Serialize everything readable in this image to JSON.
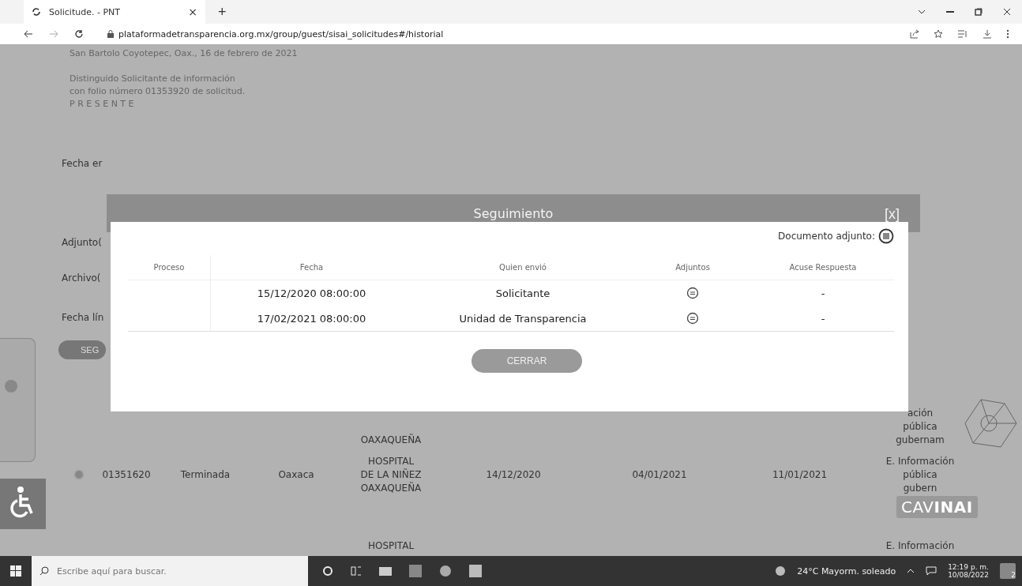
{
  "browser": {
    "tab_title": "Solicitude. - PNT",
    "tab_close": "×",
    "new_tab": "+",
    "url": "plataformadetransparencia.org.mx/group/guest/sisai_solicitudes#/historial"
  },
  "letter": {
    "lines": [
      "San Bartolo Coyotepec, Oax., 16 de febrero de 2021",
      "Distinguido Solicitante de información",
      "con folio número 01353920 de  solicitud.",
      "P R E S E N T E"
    ]
  },
  "form_labels": [
    "Fecha er",
    "Adjunto(",
    "Archivo(",
    "Fecha lín"
  ],
  "partial_button": "SEG",
  "background_rows": [
    {
      "institution": [
        "OAXAQUEÑA"
      ],
      "type": [
        "ación",
        "pública",
        "gubernam"
      ]
    },
    {
      "folio": "01351620",
      "status": "Terminada",
      "state": "Oaxaca",
      "institution": [
        "HOSPITAL",
        "DE LA NIÑEZ",
        "OAXAQUEÑA"
      ],
      "date_1": "14/12/2020",
      "date_2": "04/01/2021",
      "date_3": "11/01/2021",
      "type": [
        "E. Información",
        "pública",
        "gubern"
      ]
    },
    {
      "institution": [
        "HOSPITAL"
      ],
      "type": [
        "E. Información"
      ]
    }
  ],
  "modal": {
    "title": "Seguimiento",
    "close": "[x]",
    "attachment_label": "Documento adjunto:",
    "columns": [
      "Proceso",
      "Fecha",
      "Quien envió",
      "Adjuntos",
      "Acuse Respuesta"
    ],
    "rows": [
      {
        "date": "15/12/2020 08:00:00",
        "sender": "Solicitante",
        "response": "-"
      },
      {
        "date": "17/02/2021 08:00:00",
        "sender": "Unidad de Transparencia",
        "response": "-"
      }
    ],
    "button": "CERRAR"
  },
  "chat_widget": {
    "label": "CAV**INAI**"
  },
  "taskbar": {
    "search_placeholder": "Escribe aquí para buscar.",
    "weather": "24°C Mayorm. soleado",
    "time": "12:19 p. m.",
    "date": "10/08/2022",
    "notifications": "2"
  }
}
